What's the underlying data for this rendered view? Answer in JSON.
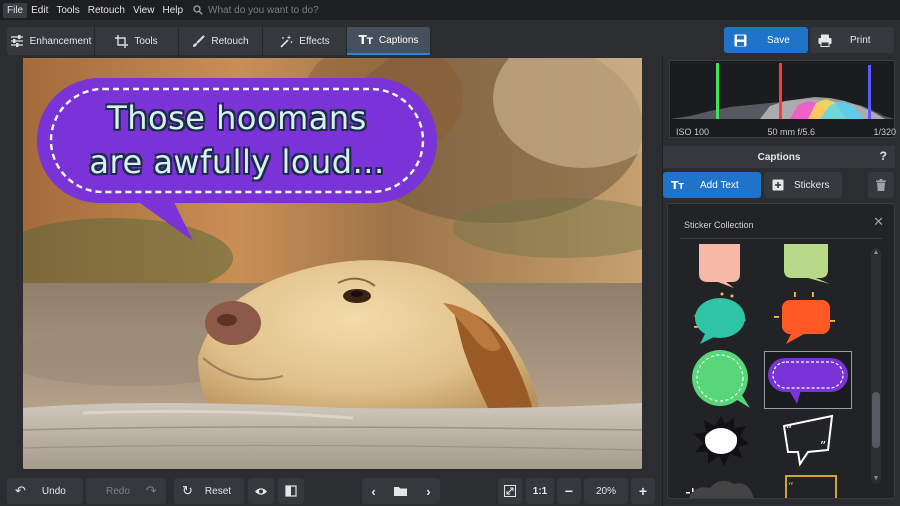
{
  "menu": {
    "items": [
      "File",
      "Edit",
      "Tools",
      "Retouch",
      "View",
      "Help"
    ],
    "search_placeholder": "What do you want to do?"
  },
  "toolbar": {
    "tabs": [
      {
        "label": "Enhancement",
        "icon": "sliders-icon"
      },
      {
        "label": "Tools",
        "icon": "crop-icon"
      },
      {
        "label": "Retouch",
        "icon": "brush-icon"
      },
      {
        "label": "Effects",
        "icon": "magic-wand-icon"
      },
      {
        "label": "Captions",
        "icon": "text-icon",
        "active": true
      }
    ],
    "save_label": "Save",
    "print_label": "Print"
  },
  "canvas": {
    "caption_line1": "Those hoomans",
    "caption_line2": "are awfully loud...",
    "bubble_color": "#7a33d6"
  },
  "bottombar": {
    "undo_label": "Undo",
    "redo_label": "Redo",
    "reset_label": "Reset",
    "actual_size_label": "1:1",
    "zoom_value": "20%"
  },
  "histogram": {
    "iso": "ISO 100",
    "lens": "50 mm f/5.6",
    "shutter": "1/320"
  },
  "captions_panel": {
    "title": "Captions",
    "help": "?",
    "add_text_label": "Add Text",
    "stickers_label": "Stickers"
  },
  "sticker_collection": {
    "title": "Sticker Collection",
    "stickers": [
      {
        "name": "pink-bubble",
        "color": "#f7b8a8"
      },
      {
        "name": "lime-bubble",
        "color": "#b9d98a"
      },
      {
        "name": "teal-bubble",
        "color": "#2fc4a6"
      },
      {
        "name": "orange-bubble",
        "color": "#ff5a26"
      },
      {
        "name": "green-dashed-bubble",
        "color": "#57d67a"
      },
      {
        "name": "purple-dashed-bubble",
        "color": "#7a33d6",
        "selected": true
      },
      {
        "name": "explosion-bubble",
        "color": "#ffffff"
      },
      {
        "name": "outline-bubble",
        "color": "#ffffff"
      }
    ]
  },
  "colors": {
    "accent": "#1f73c9",
    "background": "#2b2d31",
    "panel": "#35383d"
  }
}
